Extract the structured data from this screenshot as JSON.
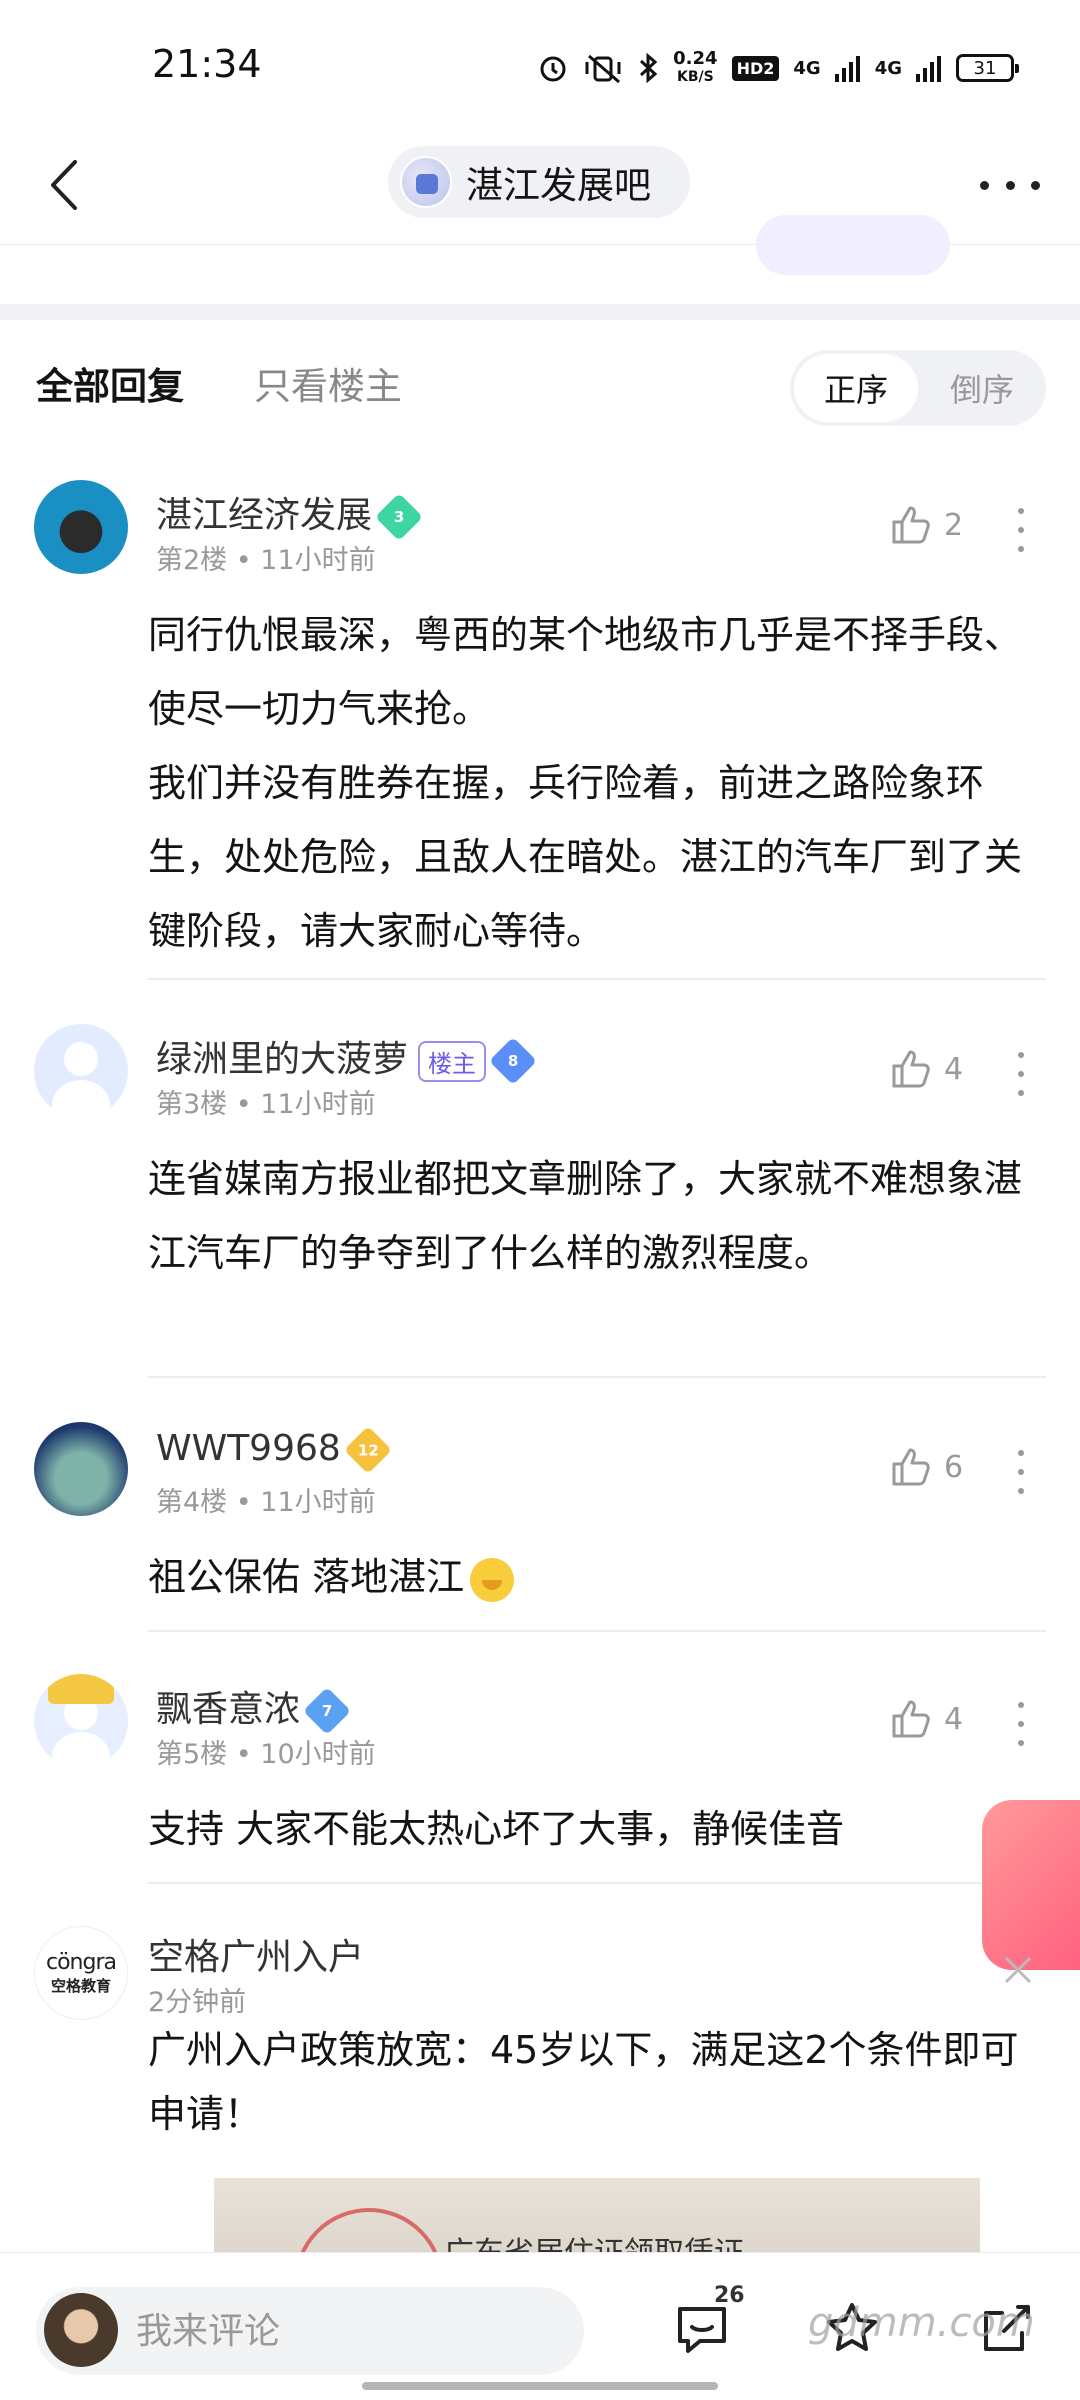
{
  "status_bar": {
    "time": "21:34",
    "net_speed_value": "0.24",
    "net_speed_unit": "KB/S",
    "hd_label": "HD2",
    "signal_1": "4G",
    "signal_2": "4G",
    "battery": "31"
  },
  "nav": {
    "forum_name": "湛江发展吧"
  },
  "filter": {
    "tab_all": "全部回复",
    "tab_owner_only": "只看楼主",
    "sort_asc": "正序",
    "sort_desc": "倒序"
  },
  "posts": [
    {
      "username": "湛江经济发展",
      "level": "3",
      "floor": "第2楼",
      "time": "11小时前",
      "likes": "2",
      "content": "同行仇恨最深，粤西的某个地级市几乎是不择手段、使尽一切力气来抢。\n我们并没有胜券在握，兵行险着，前进之路险象环生，处处危险，且敌人在暗处。湛江的汽车厂到了关键阶段，请大家耐心等待。"
    },
    {
      "username": "绿洲里的大菠萝",
      "owner_tag": "楼主",
      "level": "8",
      "floor": "第3楼",
      "time": "11小时前",
      "likes": "4",
      "content": "连省媒南方报业都把文章删除了，大家就不难想象湛江汽车厂的争夺到了什么样的激烈程度。"
    },
    {
      "username": "WWT9968",
      "level": "12",
      "floor": "第4楼",
      "time": "11小时前",
      "likes": "6",
      "content": "祖公保佑 落地湛江"
    },
    {
      "username": "飘香意浓",
      "level": "7",
      "floor": "第5楼",
      "time": "10小时前",
      "likes": "4",
      "content": "支持 大家不能太热心坏了大事，静候佳音"
    }
  ],
  "ad": {
    "logo_line1": "cöngra",
    "logo_line2": "空格教育",
    "advertiser": "空格广州入户",
    "time": "2分钟前",
    "content": "广州入户政策放宽：45岁以下，满足这2个条件即可申请！",
    "image_text": "广东省居住证领取凭证"
  },
  "bottom_bar": {
    "comment_placeholder": "我来评论",
    "comment_count": "26"
  },
  "watermark": "gdmm.com",
  "colors": {
    "accent_purple": "#6d5ce6",
    "muted_text": "#999999",
    "divider": "#ececec"
  }
}
